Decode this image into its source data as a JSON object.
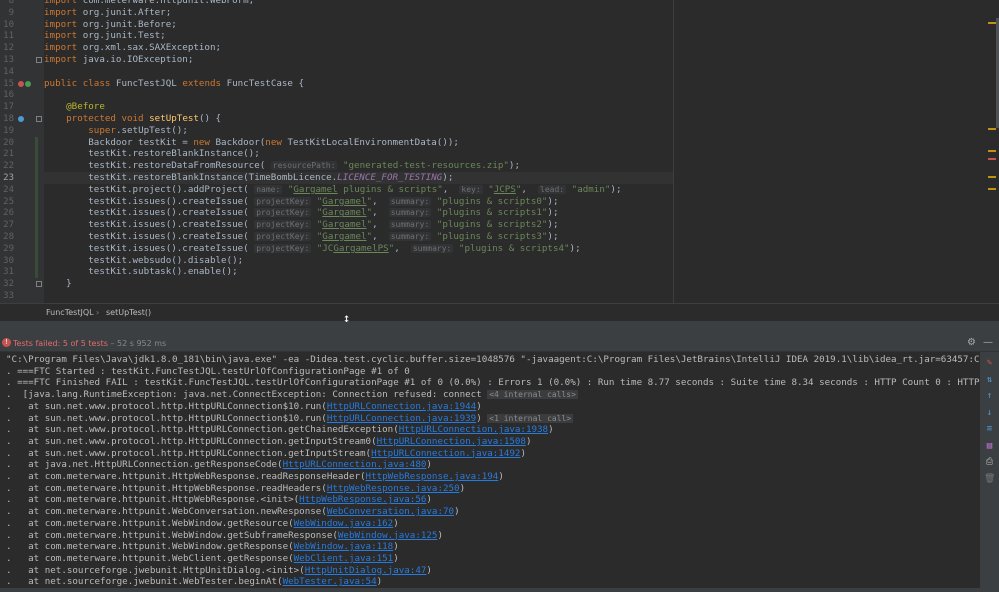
{
  "editor": {
    "lines": [
      {
        "n": "8",
        "html": "<span class=\"kw\">import</span> com.meterware.httpunit.WebForm;"
      },
      {
        "n": "9",
        "html": "<span class=\"kw\">import</span> org.junit.After;"
      },
      {
        "n": "10",
        "html": "<span class=\"kw\">import</span> org.junit.Before;"
      },
      {
        "n": "11",
        "html": "<span class=\"kw\">import</span> org.junit.Test;"
      },
      {
        "n": "12",
        "html": "<span class=\"kw\">import</span> org.xml.sax.SAXException;"
      },
      {
        "n": "13",
        "html": "<span class=\"kw\">import</span> java.io.IOException;"
      },
      {
        "n": "14",
        "html": ""
      },
      {
        "n": "15",
        "html": "<span class=\"kw\">public class</span> FuncTestJQL <span class=\"kw\">extends</span> FuncTestCase {"
      },
      {
        "n": "16",
        "html": ""
      },
      {
        "n": "17",
        "html": "    <span class=\"ann\">@Before</span>"
      },
      {
        "n": "18",
        "html": "    <span class=\"kw\">protected void</span> <span class=\"fn\">setUpTest</span>() {"
      },
      {
        "n": "19",
        "html": "        <span class=\"kw\">super</span>.setUpTest();"
      },
      {
        "n": "20",
        "html": "        Backdoor testKit = <span class=\"kw\">new</span> Backdoor(<span class=\"kw\">new</span> TestKitLocalEnvironmentData());"
      },
      {
        "n": "21",
        "html": "        testKit.restoreBlankInstance();"
      },
      {
        "n": "22",
        "html": "        testKit.restoreDataFromResource( <span class=\"ph\">resourcePath:</span> <span class=\"str\">\"generated-test-resources.zip\"</span>);"
      },
      {
        "n": "23",
        "html": "        testKit.restoreBlankInstance(TimeBombLicence.<span class=\"st\">LICENCE_FOR_TESTING</span>);",
        "current": true
      },
      {
        "n": "24",
        "html": "        testKit.project().addProject( <span class=\"ph\">name:</span> <span class=\"str\">\"<span class=\"ul\">Gargamel</span> plugins &amp; scripts\"</span>,  <span class=\"ph\">key:</span> <span class=\"str\">\"<span class=\"ul\">JCPS</span>\"</span>,  <span class=\"ph\">lead:</span> <span class=\"str\">\"admin\"</span>);"
      },
      {
        "n": "25",
        "html": "        testKit.issues().createIssue( <span class=\"ph\">projectKey:</span> <span class=\"str\">\"<span class=\"ul\">Gargamel</span>\"</span>,  <span class=\"ph\">summary:</span> <span class=\"str\">\"plugins &amp; scripts0\"</span>);"
      },
      {
        "n": "26",
        "html": "        testKit.issues().createIssue( <span class=\"ph\">projectKey:</span> <span class=\"str\">\"<span class=\"ul\">Gargamel</span>\"</span>,  <span class=\"ph\">summary:</span> <span class=\"str\">\"plugins &amp; scripts1\"</span>);"
      },
      {
        "n": "27",
        "html": "        testKit.issues().createIssue( <span class=\"ph\">projectKey:</span> <span class=\"str\">\"<span class=\"ul\">Gargamel</span>\"</span>,  <span class=\"ph\">summary:</span> <span class=\"str\">\"plugins &amp; scripts2\"</span>);"
      },
      {
        "n": "28",
        "html": "        testKit.issues().createIssue( <span class=\"ph\">projectKey:</span> <span class=\"str\">\"<span class=\"ul\">Gargamel</span>\"</span>,  <span class=\"ph\">summary:</span> <span class=\"str\">\"plugins &amp; scripts3\"</span>);"
      },
      {
        "n": "29",
        "html": "        testKit.issues().createIssue( <span class=\"ph\">projectKey:</span> <span class=\"str\">\"JC<span class=\"ul\">GargamelPS</span>\"</span>,  <span class=\"ph\">summary:</span> <span class=\"str\">\"plugins &amp; scripts4\"</span>);"
      },
      {
        "n": "30",
        "html": "        testKit.websudo().disable();"
      },
      {
        "n": "31",
        "html": "        testKit.subtask().enable();"
      },
      {
        "n": "32",
        "html": "    }"
      },
      {
        "n": "33",
        "html": ""
      }
    ]
  },
  "breadcrumb": {
    "class_name": "FuncTestJQL",
    "method_name": "setUpTest()",
    "separator": "›"
  },
  "run": {
    "status": "Tests failed: 5 of 5 tests",
    "duration": "– 52 s 952 ms",
    "fail_glyph": "!",
    "gear_glyph": "⚙",
    "minimize_glyph": "—"
  },
  "console": {
    "lines": [
      {
        "html": "\"C:\\Program Files\\Java\\jdk1.8.0_181\\bin\\java.exe\" -ea -Didea.test.cyclic.buffer.size=1048576 \"-javaagent:C:\\Program Files\\JetBrains\\IntelliJ IDEA 2019.1\\lib\\idea_rt.jar=63457:C:\\Program"
      },
      {
        "html": ". ===FTC Started : testKit.FuncTestJQL.testUrlOfConfigurationPage #1 of 0"
      },
      {
        "html": ". ===FTC Finished FAIL : testKit.FuncTestJQL.testUrlOfConfigurationPage #1 of 0 (0.0%) : Errors 1 (0.0%) : Run time 8.77 seconds : Suite time 8.34 seconds : HTTP Count 0 : HTTP Time 0ms"
      },
      {
        "html": ".  [java.lang.RuntimeException: java.net.ConnectException: Connection refused: connect <span class=\"fold\">&lt;4 internal calls&gt;</span>"
      },
      {
        "html": ".   at sun.net.www.protocol.http.HttpURLConnection$10.run(<span class=\"ln\">HttpURLConnection.java:1944</span>)"
      },
      {
        "html": ".   at sun.net.www.protocol.http.HttpURLConnection$10.run(<span class=\"ln\">HttpURLConnection.java:1939</span>) <span class=\"fold\">&lt;1 internal call&gt;</span>"
      },
      {
        "html": ".   at sun.net.www.protocol.http.HttpURLConnection.getChainedException(<span class=\"ln\">HttpURLConnection.java:1938</span>)"
      },
      {
        "html": ".   at sun.net.www.protocol.http.HttpURLConnection.getInputStream0(<span class=\"ln\">HttpURLConnection.java:1508</span>)"
      },
      {
        "html": ".   at sun.net.www.protocol.http.HttpURLConnection.getInputStream(<span class=\"ln\">HttpURLConnection.java:1492</span>)"
      },
      {
        "html": ".   at java.net.HttpURLConnection.getResponseCode(<span class=\"ln\">HttpURLConnection.java:480</span>)"
      },
      {
        "html": ".   at com.meterware.httpunit.HttpWebResponse.readResponseHeader(<span class=\"ln\">HttpWebResponse.java:194</span>)"
      },
      {
        "html": ".   at com.meterware.httpunit.HttpWebResponse.readHeaders(<span class=\"ln\">HttpWebResponse.java:250</span>)"
      },
      {
        "html": ".   at com.meterware.httpunit.HttpWebResponse.&lt;init&gt;(<span class=\"ln\">HttpWebResponse.java:56</span>)"
      },
      {
        "html": ".   at com.meterware.httpunit.WebConversation.newResponse(<span class=\"ln\">WebConversation.java:70</span>)"
      },
      {
        "html": ".   at com.meterware.httpunit.WebWindow.getResource(<span class=\"ln\">WebWindow.java:162</span>)"
      },
      {
        "html": ".   at com.meterware.httpunit.WebWindow.getSubframeResponse(<span class=\"ln\">WebWindow.java:125</span>)"
      },
      {
        "html": ".   at com.meterware.httpunit.WebWindow.getResponse(<span class=\"ln\">WebWindow.java:118</span>)"
      },
      {
        "html": ".   at com.meterware.httpunit.WebClient.getResponse(<span class=\"ln\">WebClient.java:151</span>)"
      },
      {
        "html": ".   at net.sourceforge.jwebunit.HttpUnitDialog.&lt;init&gt;(<span class=\"ln\">HttpUnitDialog.java:47</span>)"
      },
      {
        "html": ".   at net.sourceforge.jwebunit.WebTester.beginAt(<span class=\"ln\">WebTester.java:54</span>)"
      }
    ]
  },
  "tools": [
    {
      "name": "clear-all-icon",
      "glyph": "✎",
      "color": "#c75450"
    },
    {
      "name": "sort-icon",
      "glyph": "⇅",
      "color": "#4e9ad3"
    },
    {
      "name": "up-arrow-icon",
      "glyph": "↑",
      "color": "#4e9ad3"
    },
    {
      "name": "down-arrow-icon",
      "glyph": "↓",
      "color": "#4e9ad3"
    },
    {
      "name": "soft-wrap-icon",
      "glyph": "≡",
      "color": "#4e9ad3"
    },
    {
      "name": "scroll-to-end-icon",
      "glyph": "▤",
      "color": "#c679dd"
    },
    {
      "name": "print-icon",
      "glyph": "⎙",
      "color": "#bbbbbb"
    },
    {
      "name": "trash-icon",
      "glyph": "🗑",
      "color": "#777777"
    }
  ]
}
